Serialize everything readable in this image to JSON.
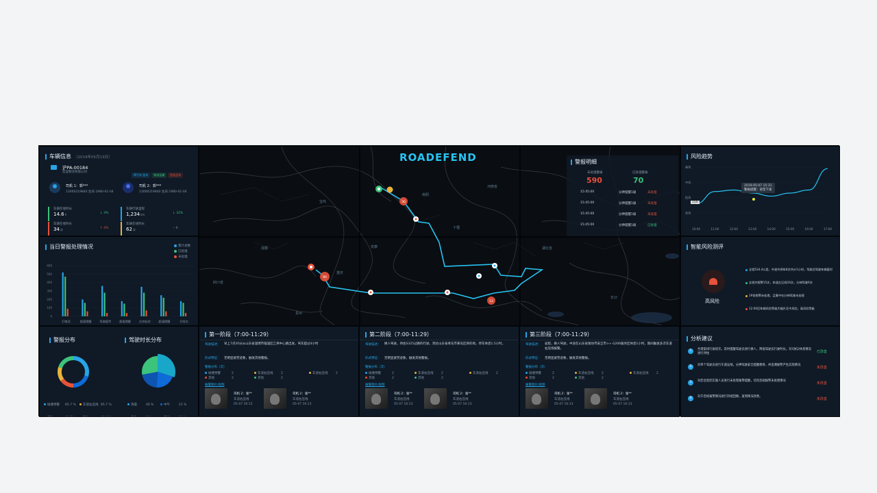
{
  "vehicle": {
    "title": "车辆信息",
    "date": "（2019年05月13日）",
    "plate": "沪PA-00184",
    "company": "宏运物流有限公司",
    "tags": [
      {
        "label": "牵引车 挂车",
        "color": "#27a5e8"
      },
      {
        "label": "物流运输",
        "color": "#3cc37c"
      },
      {
        "label": "危险品车",
        "color": "#e8523b"
      }
    ],
    "driver1": {
      "name": "司机 1：郭***",
      "info": "13000219840  生日:1980-01-04"
    },
    "driver2": {
      "name": "司机 2：郭***",
      "info": "13000219840  生日:1980-01-04"
    },
    "stats": [
      {
        "label": "车辆在线时长",
        "value": "14.6",
        "unit": "h",
        "change": "↓ 3%",
        "color": "#3cc37c"
      },
      {
        "label": "车辆行驶里程",
        "value": "1,234",
        "unit": "km",
        "change": "↓ 32%",
        "color": "#27a5e8"
      },
      {
        "label": "车辆在线时长",
        "value": "34",
        "unit": "次",
        "change": "↑ 4%",
        "color": "#e8523b"
      },
      {
        "label": "车辆在线时长",
        "value": "62",
        "unit": "次",
        "change": "-- 0",
        "color": "#e8b33b"
      }
    ]
  },
  "alarm_chart": {
    "title": "当日警报处理情况",
    "legend": [
      {
        "label": "累计总数",
        "color": "#27a5e8"
      },
      {
        "label": "已处理",
        "color": "#3cc37c"
      },
      {
        "label": "未处理",
        "color": "#e8523b"
      }
    ],
    "yticks": [
      "600",
      "500",
      "400",
      "300",
      "200",
      "100",
      "0"
    ],
    "categories": [
      "打电话",
      "超速提醒",
      "驾驶疲劳",
      "超速提醒",
      "左排右刹",
      "超速提醒",
      "打哈欠"
    ]
  },
  "chart_data": [
    {
      "type": "bar",
      "title": "当日警报处理情况",
      "categories": [
        "打电话",
        "超速提醒",
        "驾驶疲劳",
        "超速提醒",
        "左排右刹",
        "超速提醒",
        "打哈欠"
      ],
      "ylim": [
        0,
        600
      ],
      "series": [
        {
          "name": "累计总数",
          "values": [
            520,
            200,
            360,
            180,
            350,
            250,
            180
          ]
        },
        {
          "name": "已处理",
          "values": [
            470,
            160,
            280,
            150,
            280,
            220,
            160
          ]
        },
        {
          "name": "未处理",
          "values": [
            90,
            60,
            40,
            40,
            70,
            60,
            40
          ]
        }
      ]
    },
    {
      "type": "line",
      "title": "风险趋势",
      "x": [
        "10:00",
        "11:00",
        "12:00",
        "13:00",
        "14:00",
        "15:00",
        "16:00",
        "17:00"
      ],
      "yticks": [
        "高风险",
        "中风险",
        "低风险",
        "无风险"
      ],
      "ylim": [
        0,
        3
      ],
      "values": [
        0.6,
        1.4,
        1.5,
        1.3,
        1.1,
        1.3,
        1.5,
        2.9
      ]
    },
    {
      "type": "pie",
      "title": "警报分布",
      "labels": [
        "碰撞预警",
        "车道左压线",
        "其他",
        "其他",
        "车道左压线"
      ],
      "values": [
        85.7,
        85.7,
        85.7,
        85.7,
        85.7
      ]
    },
    {
      "type": "pie",
      "title": "驾驶时长分布",
      "labels": [
        "清晨",
        "中午",
        "黄昏",
        "夜间"
      ],
      "values": [
        46,
        21,
        32,
        21
      ]
    }
  ],
  "alarm_pie": {
    "title": "警报分布",
    "legend": [
      {
        "label": "碰撞预警",
        "value": "85.7 %",
        "color": "#27a5e8"
      },
      {
        "label": "车道左压线",
        "value": "85.7 %",
        "color": "#e8b33b"
      },
      {
        "label": "其他",
        "value": "85.7 %",
        "color": "#e8523b"
      },
      {
        "label": "其他",
        "value": "85.7 %",
        "color": "#3cc37c"
      },
      {
        "label": "车道左压线",
        "value": "85.7 %",
        "color": "#e8b33b"
      }
    ],
    "slices": [
      {
        "value": 30,
        "color": "#27a5e8"
      },
      {
        "value": 20,
        "color": "#0e6bd8"
      },
      {
        "value": 15,
        "color": "#e8523b"
      },
      {
        "value": 15,
        "color": "#e8b33b"
      },
      {
        "value": 20,
        "color": "#3cc37c"
      }
    ]
  },
  "drive_pie": {
    "title": "驾驶时长分布",
    "legend": [
      {
        "label": "清晨",
        "value": "46 %",
        "color": "#27a5e8"
      },
      {
        "label": "中午",
        "value": "21 %",
        "color": "#0e6bd8"
      },
      {
        "label": "黄昏",
        "value": "32 %",
        "color": "#e8b33b"
      },
      {
        "label": "夜间",
        "value": "21 %",
        "color": "#3cc37c"
      }
    ],
    "slices": [
      {
        "value": 30,
        "color": "#18a7c9"
      },
      {
        "value": 21,
        "color": "#0e6bd8"
      },
      {
        "value": 21,
        "color": "#0d55b0"
      },
      {
        "value": 28,
        "color": "#3cc37c"
      }
    ]
  },
  "map": {
    "logo": "ROADEFEND",
    "labels": [
      "南阳",
      "河南省",
      "安康",
      "宝鸡",
      "湖北省",
      "十堰",
      "重庆",
      "成都",
      "长沙",
      "四川省",
      "贵州"
    ],
    "markers": [
      {
        "label": "30",
        "color": "#e8523b"
      },
      {
        "label": "99",
        "color": "#e8523b"
      },
      {
        "label": "12",
        "color": "#e8523b"
      }
    ]
  },
  "alarm_detail": {
    "title": "警报明细",
    "unprocessed_label": "未处理警报",
    "unprocessed_value": "590",
    "processed_label": "已处理警报",
    "processed_value": "70",
    "rows": [
      {
        "time": "15:45:00",
        "type": "分神提醒1级",
        "status": "未处理",
        "color": "#e8523b"
      },
      {
        "time": "15:45:00",
        "type": "分神提醒1级",
        "status": "未处理",
        "color": "#e8523b"
      },
      {
        "time": "15:45:00",
        "type": "分神提醒1级",
        "status": "未处理",
        "color": "#e8523b"
      },
      {
        "time": "15:45:00",
        "type": "分神提醒1级",
        "status": "已处理",
        "color": "#3cc37c"
      }
    ]
  },
  "risk_trend": {
    "title": "风险趋势",
    "tooltip_time": "2019-05-07 15:31",
    "tooltip_text": "警报提醒：语音下发",
    "yticks": [
      "高风",
      "中风",
      "低风",
      "无风"
    ],
    "xticks": [
      "10:00",
      "11:00",
      "12:00",
      "13:00",
      "14:00",
      "15:00",
      "16:00",
      "17:00"
    ],
    "badge": "150"
  },
  "risk_eval": {
    "title": "智能风险测评",
    "level": "高风险",
    "items": [
      {
        "text": "全程534.4公里，中途共停车8次共计1小时，驾驶员驾驶车辆疲时",
        "color": "#27a5e8"
      },
      {
        "text": "全程共报警15次，车道左压线16次，分神驾驶9次",
        "color": "#3cc37c"
      },
      {
        "text": "19条报警未处理，且集中在分神驾驶未处理",
        "color": "#e8b33b"
      },
      {
        "text": "12:00后车辆风险等级大幅升至中风险，高风险等级",
        "color": "#e8523b"
      }
    ]
  },
  "stages": [
    {
      "title": "第一阶段（7:00-11:29）",
      "desc_label": "驾驶描述：",
      "desc": "早上7点20分从山东省淄博市临淄区乙烯中心路出发，驾车超过4小时",
      "feature_label": "形式特征：",
      "feature": "无明显疲劳迹象，触发其他警报。",
      "dist_label": "警报分布（次）",
      "dist": [
        {
          "label": "碰撞预警",
          "value": "2",
          "color": "#27a5e8"
        },
        {
          "label": "车道右压线",
          "value": "2",
          "color": "#e8b33b"
        },
        {
          "label": "车道右压线",
          "value": "2",
          "color": "#e8b33b"
        },
        {
          "label": "其他",
          "value": "2",
          "color": "#e8523b"
        },
        {
          "label": "其他",
          "value": "2",
          "color": "#3cc37c"
        }
      ],
      "media_label": "报警图片/视频",
      "snaps": [
        {
          "driver": "司机 2：张**",
          "event": "车道右压线",
          "time": "05-07 16:13"
        },
        {
          "driver": "司机 2：张**",
          "event": "车道右压线",
          "time": "05-07 16:13"
        }
      ]
    },
    {
      "title": "第二阶段（7:00-11:29）",
      "desc_label": "驾驶描述：",
      "desc": "换人驾驶，持住S325过路的行驶，到达山东省青岛市黄岛区目的地，停车休息1.5小时。",
      "feature_label": "形式特征：",
      "feature": "无明显疲劳迹象，触发其他警报。",
      "dist_label": "警报分布（次）",
      "dist": [
        {
          "label": "碰撞预警",
          "value": "2",
          "color": "#27a5e8"
        },
        {
          "label": "车道右压线",
          "value": "2",
          "color": "#e8b33b"
        },
        {
          "label": "车道右压线",
          "value": "2",
          "color": "#e8b33b"
        },
        {
          "label": "其他",
          "value": "2",
          "color": "#e8523b"
        },
        {
          "label": "其他",
          "value": "2",
          "color": "#3cc37c"
        }
      ],
      "media_label": "报警图片/视频",
      "snaps": [
        {
          "driver": "司机 2：张**",
          "event": "车道右压线",
          "time": "05-07 16:13"
        },
        {
          "driver": "司机 2：张**",
          "event": "车道右压线",
          "time": "05-07 16:13"
        }
      ]
    },
    {
      "title": "第三阶段（7:00-11:29）",
      "desc_label": "驾驶描述：",
      "desc": "返程，换人驾驶，中途在山东省潍坊市安丘市>> G206服务区休息1小时，期间触发多次车道右压线报警。",
      "feature_label": "形式特征：",
      "feature": "无明显疲劳迹象，触发其他警报。",
      "dist_label": "警报分布（次）",
      "dist": [
        {
          "label": "碰撞预警",
          "value": "2",
          "color": "#27a5e8"
        },
        {
          "label": "车道右压线",
          "value": "2",
          "color": "#e8b33b"
        },
        {
          "label": "车道右压线",
          "value": "2",
          "color": "#e8b33b"
        },
        {
          "label": "其他",
          "value": "2",
          "color": "#e8523b"
        },
        {
          "label": "其他",
          "value": "2",
          "color": "#3cc37c"
        }
      ],
      "media_label": "报警图片/视频",
      "snaps": [
        {
          "driver": "司机 2：张**",
          "event": "车道右压线",
          "time": "05-07 16:13"
        },
        {
          "driver": "司机 2：张**",
          "event": "车道右压线",
          "time": "05-07 16:13"
        }
      ]
    }
  ],
  "advice": {
    "title": "分析建议",
    "items": [
      {
        "num": "1",
        "text": "合理安排行驶班次，及时提醒驾驶员进行换人，降低驾驶员行驶时长，对司机2休息情况进行评估",
        "status": "已改善",
        "color": "#3cc37c"
      },
      {
        "num": "2",
        "text": "对单个驾驶员进行车道压线，分神驾驶安全提醒教育，并追溯报警产生实际情况",
        "status": "未改善",
        "color": "#e8523b"
      },
      {
        "num": "3",
        "text": "对后台监控实施人员进行未处理报警提醒，切勿忽视报警未处理情况",
        "status": "未改善",
        "color": "#e8523b"
      },
      {
        "num": "4",
        "text": "对于后续报警情况进行持续回顾，直到情况改善。",
        "status": "未改善",
        "color": "#e8523b"
      }
    ]
  }
}
